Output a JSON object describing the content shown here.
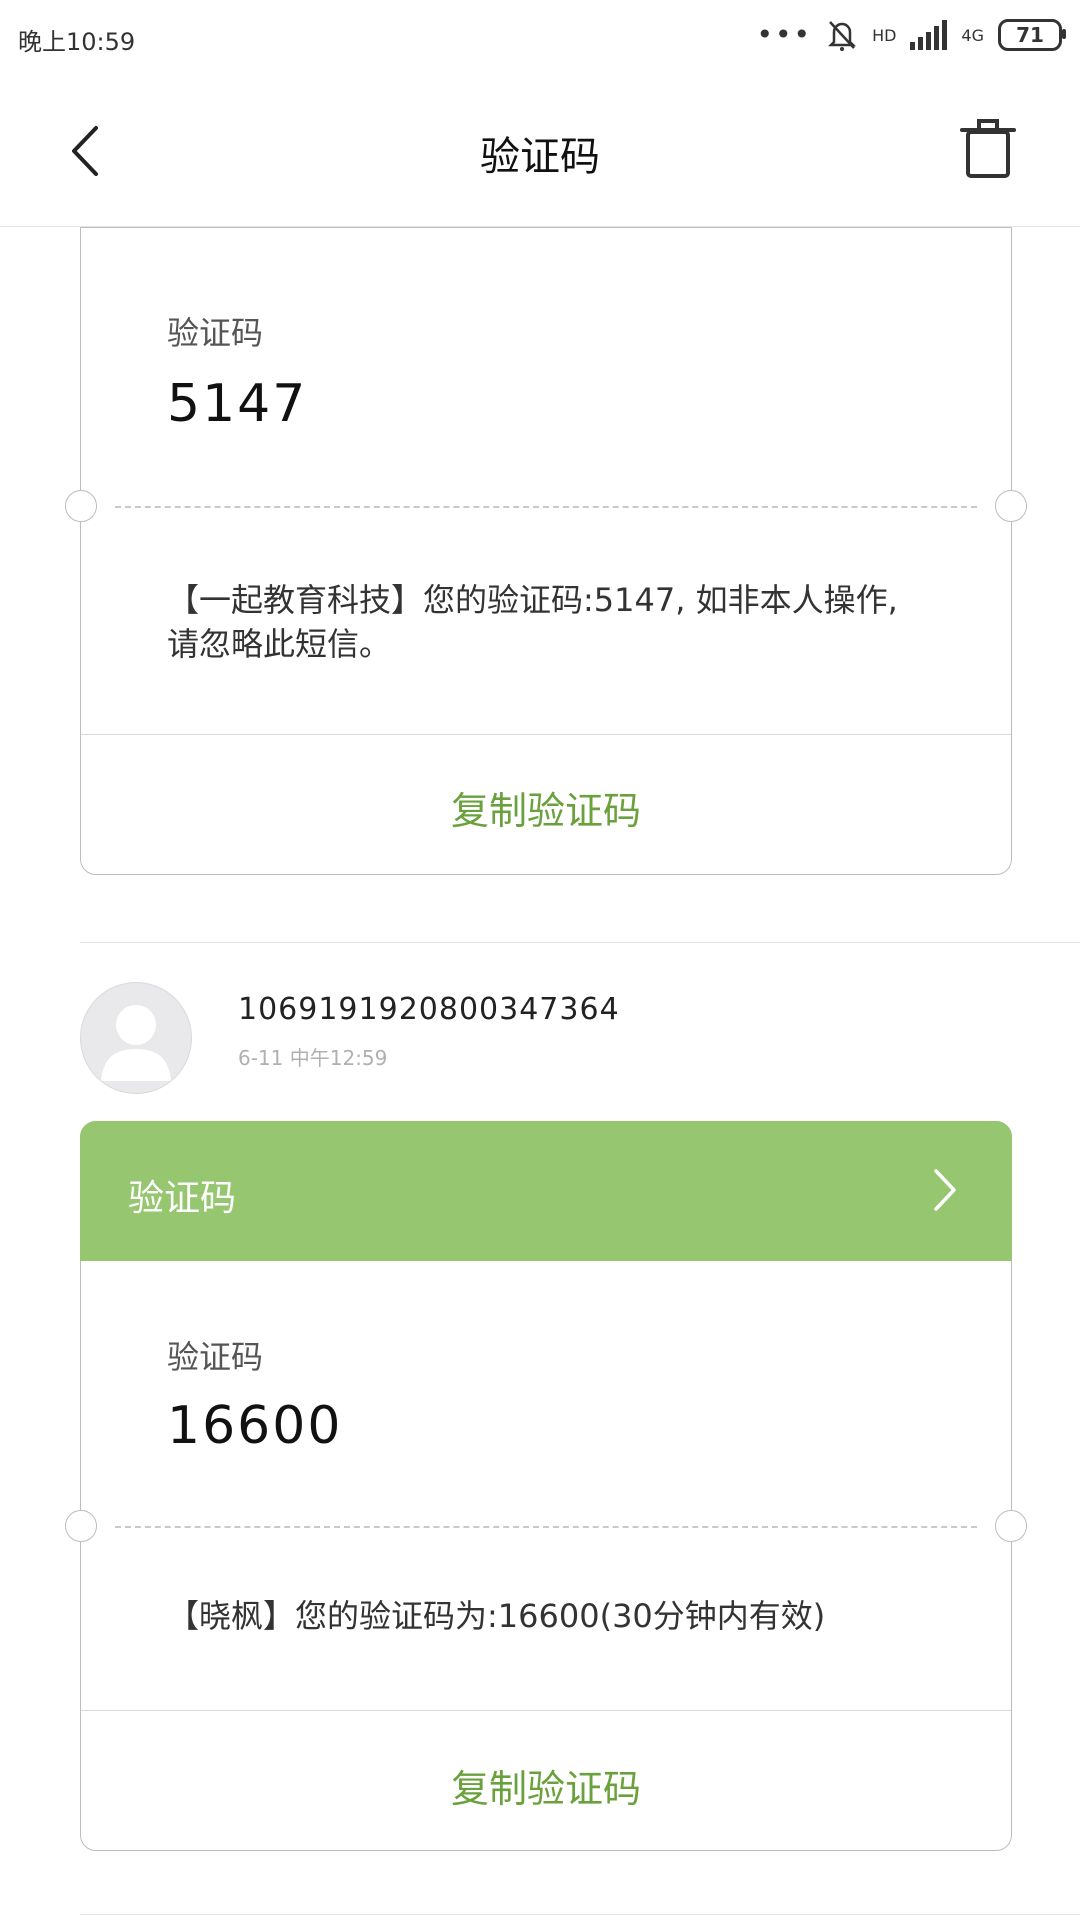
{
  "status_bar": {
    "time": "晚上10:59",
    "network": "4G",
    "hd": "HD",
    "battery": "71",
    "icons": [
      "more-dots-icon",
      "bell-muted-icon",
      "signal-icon",
      "battery-icon"
    ]
  },
  "header": {
    "title": "验证码",
    "back_icon": "chevron-left-icon",
    "delete_icon": "trash-icon"
  },
  "card1": {
    "code_label": "验证码",
    "code": "5147",
    "message": "【一起教育科技】您的验证码:5147, 如非本人操作, 请忽略此短信。",
    "copy_label": "复制验证码"
  },
  "sender2": {
    "number": "10691919208003473​64",
    "time": "6-11 中午12:59"
  },
  "card2": {
    "header_label": "验证码",
    "code_label": "验证码",
    "code": "16600",
    "message": "【晓枫】您的验证码为:16600(30分钟内有效)",
    "copy_label": "复制验证码"
  },
  "colors": {
    "accent_green": "#96c66f",
    "copy_green": "#6aa13c",
    "border": "#bdbdbd"
  }
}
